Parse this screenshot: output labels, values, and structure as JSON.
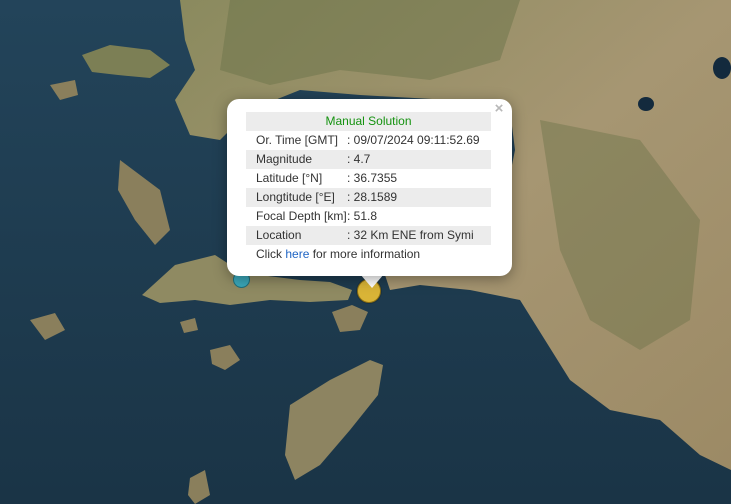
{
  "popup": {
    "title": "Manual Solution",
    "rows": [
      {
        "label": "Or. Time [GMT]",
        "value": ": 09/07/2024 09:11:52.69"
      },
      {
        "label": "Magnitude",
        "value": ": 4.7"
      },
      {
        "label": "Latitude [°N]",
        "value": ": 36.7355"
      },
      {
        "label": "Longtitude [°E]",
        "value": ": 28.1589"
      },
      {
        "label": "Focal Depth [km]",
        "value": ": 51.8"
      },
      {
        "label": "Location",
        "value": ": 32 Km ENE from Symi"
      }
    ],
    "footer_prefix": "Click ",
    "footer_link": "here",
    "footer_suffix": " for more information",
    "close_icon": "×"
  },
  "markers": [
    {
      "name": "selected-earthquake-marker",
      "color": "#d9b437"
    },
    {
      "name": "earthquake-marker",
      "color": "#3aa7b9"
    }
  ],
  "colors": {
    "title_green": "#14920f",
    "link_blue": "#1f64c4",
    "sea": "#1d3a4f",
    "land": "#a2916a"
  }
}
